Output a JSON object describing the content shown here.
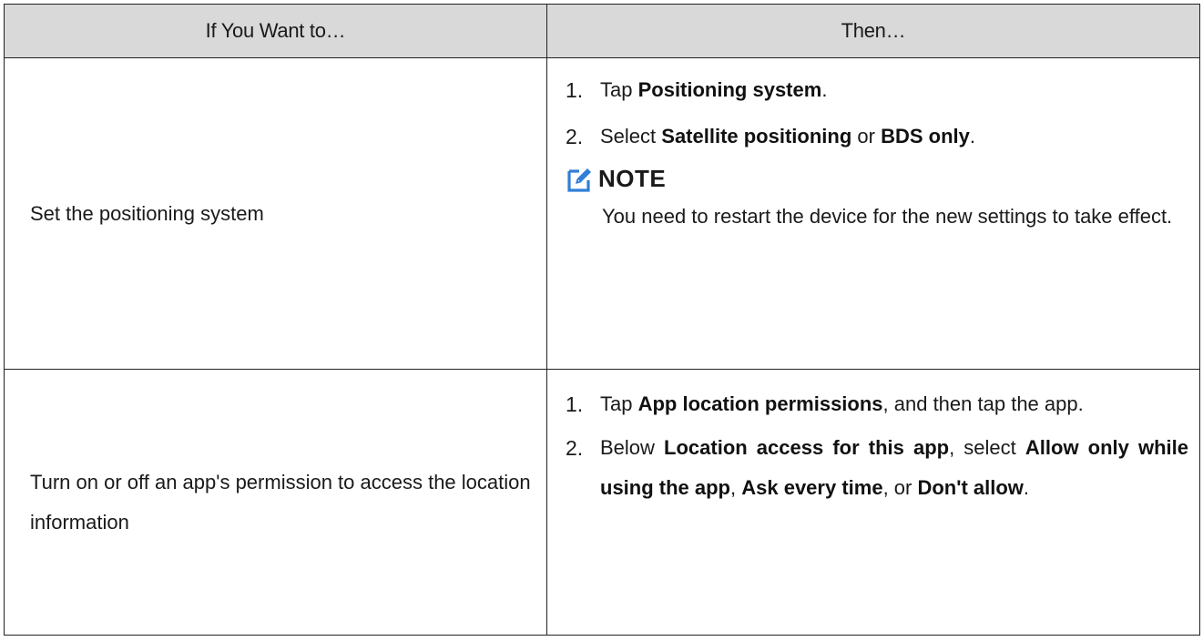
{
  "table": {
    "header": {
      "col1": "If You Want to…",
      "col2": "Then…"
    },
    "rows": [
      {
        "action": "Set the positioning system",
        "steps": [
          {
            "num": "1.",
            "parts": [
              "Tap ",
              "Positioning system",
              "."
            ]
          },
          {
            "num": "2.",
            "parts": [
              "Select ",
              "Satellite positioning",
              " or ",
              "BDS only",
              "."
            ]
          }
        ],
        "note": {
          "title": "NOTE",
          "text": "You need to restart the device for the new settings to take effect."
        }
      },
      {
        "action": "Turn on or off an app's permission to access the location information",
        "steps": [
          {
            "num": "1.",
            "parts": [
              "Tap ",
              "App location permissions",
              ", and then tap the app."
            ]
          },
          {
            "num": "2.",
            "parts": [
              "Below ",
              "Location access for this app",
              ", select ",
              "Allow only while using the app",
              ", ",
              "Ask every time",
              ", or ",
              "Don't allow",
              "."
            ]
          }
        ]
      }
    ]
  },
  "colors": {
    "header_bg": "#d9d9d9",
    "note_icon": "#2f7fd8"
  },
  "icons": {
    "note": "pencil-edit-icon"
  }
}
